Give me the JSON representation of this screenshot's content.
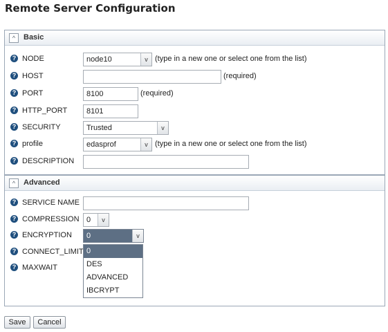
{
  "page": {
    "title": "Remote Server Configuration"
  },
  "basic": {
    "header": "Basic",
    "node": {
      "label": "NODE",
      "value": "node10",
      "hint": "(type in a new one or select one from the list)"
    },
    "host": {
      "label": "HOST",
      "value": "",
      "hint": "(required)"
    },
    "port": {
      "label": "PORT",
      "value": "8100",
      "hint": "(required)"
    },
    "http_port": {
      "label": "HTTP_PORT",
      "value": "8101"
    },
    "security": {
      "label": "SECURITY",
      "value": "Trusted"
    },
    "profile": {
      "label": "profile",
      "value": "edasprof",
      "hint": "(type in a new one or select one from the list)"
    },
    "description": {
      "label": "DESCRIPTION",
      "value": ""
    }
  },
  "advanced": {
    "header": "Advanced",
    "service_name": {
      "label": "SERVICE NAME",
      "value": ""
    },
    "compression": {
      "label": "COMPRESSION",
      "value": "0"
    },
    "encryption": {
      "label": "ENCRYPTION",
      "value": "0",
      "options": [
        "0",
        "DES",
        "ADVANCED",
        "IBCRYPT"
      ]
    },
    "connect_limit": {
      "label": "CONNECT_LIMIT"
    },
    "maxwait": {
      "label": "MAXWAIT"
    }
  },
  "icons": {
    "help": "?",
    "collapse": "^",
    "dropdown": "v"
  },
  "buttons": {
    "save": "Save",
    "cancel": "Cancel"
  },
  "colors": {
    "help_icon": "#1f4f7e",
    "selection": "#5d6f84",
    "border": "#9aa7b6"
  }
}
